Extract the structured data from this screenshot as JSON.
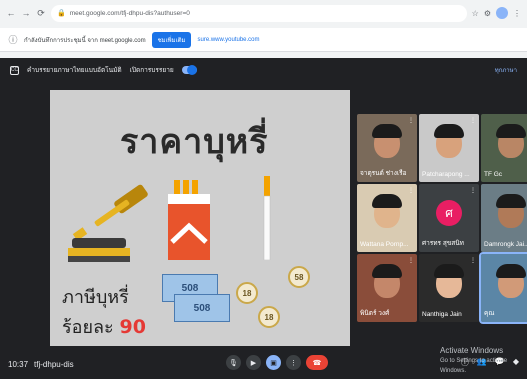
{
  "browser": {
    "url": "meet.google.com/tfj-dhpu-dis?authuser=0",
    "bookmark_text": "กำลังบันทึกการประชุมนี้ จาก meet.google.com",
    "bookmark_button": "ชมเพิ่มเติม",
    "bookmark_link": "sure.www.youtube.com"
  },
  "captions_bar": {
    "label": "คำบรรยายภาษาไทยแบบอัตโนมัติ",
    "toggle_label": "เปิดการบรรยาย",
    "right_link": "ทุกภาษา"
  },
  "slide": {
    "title": "ราคาบุหรี่",
    "tax_label": "ภาษีบุหรี่",
    "tax_rate_prefix": "ร้อยละ",
    "tax_rate_value": "90",
    "coin_values": [
      "58",
      "18",
      "18"
    ],
    "bill_values": [
      "508",
      "508"
    ]
  },
  "participants": [
    {
      "name": "จาตุรนต์ ช่างเรือ",
      "type": "video",
      "skin": "#c89070",
      "bg": "#7a6a5a"
    },
    {
      "name": "Patcharapong ...",
      "type": "video",
      "skin": "#d8a27c",
      "bg": "#c9c9c9"
    },
    {
      "name": "TF Gc",
      "type": "video",
      "skin": "#b98665",
      "bg": "#4f5f4a"
    },
    {
      "name": "Wattana Pornp...",
      "type": "video",
      "skin": "#e0b48c",
      "bg": "#d9cbb2"
    },
    {
      "name": "ศารทร สุขสนิท",
      "type": "initial",
      "initial": "ศ"
    },
    {
      "name": "Damrongk Jai...",
      "type": "video",
      "skin": "#b07a58",
      "bg": "#6b7d86"
    },
    {
      "name": "พินิตร์ วงศ์",
      "type": "video",
      "skin": "#c4876a",
      "bg": "#8a4d3a"
    },
    {
      "name": "Nanthiga Jain",
      "type": "video",
      "skin": "#e6b898",
      "bg": "#2b2b2b"
    },
    {
      "name": "คุณ",
      "type": "video",
      "skin": "#d19a78",
      "bg": "#5b86a6"
    }
  ],
  "bottom_bar": {
    "time": "10:37",
    "meeting_code": "tfj-dhpu-dis"
  },
  "watermark": {
    "title": "Activate Windows",
    "subtitle": "Go to Settings to activate Windows."
  },
  "colors": {
    "meet_bg": "#202124",
    "accent_blue": "#8ab4f8",
    "end_call_red": "#ea4335",
    "slide_bg": "#cfcfcf",
    "tax_highlight": "#e53935"
  }
}
